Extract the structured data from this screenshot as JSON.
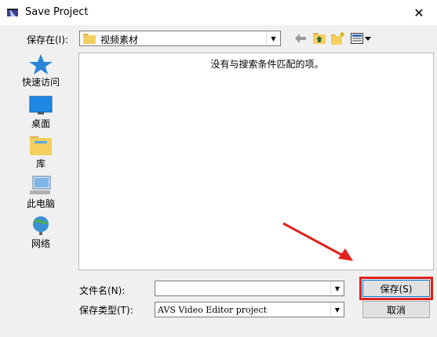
{
  "window": {
    "title": "Save Project"
  },
  "toolbar": {
    "lookin_label": "保存在(I):",
    "lookin_value": "视频素材"
  },
  "places": [
    {
      "label": "快速访问",
      "icon": "star-icon"
    },
    {
      "label": "桌面",
      "icon": "desktop-icon"
    },
    {
      "label": "库",
      "icon": "library-folder-icon"
    },
    {
      "label": "此电脑",
      "icon": "computer-icon"
    },
    {
      "label": "网络",
      "icon": "network-icon"
    }
  ],
  "filelist": {
    "empty_message": "没有与搜索条件匹配的项。"
  },
  "form": {
    "filename_label": "文件名(N):",
    "filename_value": "",
    "filetype_label": "保存类型(T):",
    "filetype_value": "AVS Video Editor project"
  },
  "buttons": {
    "save": "保存(S)",
    "cancel": "取消"
  },
  "colors": {
    "highlight": "#e0211c",
    "arrow": "#e0211c",
    "accent": "#0078d7"
  }
}
